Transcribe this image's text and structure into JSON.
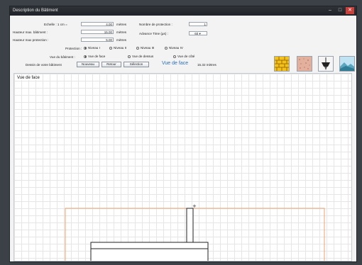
{
  "window": {
    "title": "Description du Bâtiment",
    "controls": [
      "–",
      "□",
      "✕"
    ]
  },
  "form": {
    "echelle": {
      "label": "Echelle : 1 cm =",
      "value": "4.00",
      "unit": "mètres"
    },
    "hauteur_batiment": {
      "label": "Hauteur max. bâtiment :",
      "value": "15.00",
      "unit": "mètres"
    },
    "hauteur_protection": {
      "label": "Hauteur max protection :",
      "value": "5.00",
      "unit": "mètres"
    },
    "nombre_protection": {
      "label": "Nombre de protection :",
      "value": "1"
    },
    "avance_time": {
      "label": "Advance Time (µs) :",
      "value": "60"
    },
    "protection": {
      "label": "Protection :",
      "options": [
        "Niveau I",
        "Niveau II",
        "Niveau III",
        "Niveau IV"
      ],
      "selected": 0
    },
    "vue": {
      "label": "Vue du bâtiment :",
      "options": [
        "Vue de face",
        "Vue de dessus",
        "Vue de côté"
      ],
      "selected": 0
    },
    "dessin_label": "Dessin de votre bâtiment",
    "buttons": {
      "nouveau": "Nouveau",
      "retour": "Retour",
      "selection": "Sélection"
    },
    "view_title": "Vue de face",
    "coords": "15.32 mètres"
  },
  "tools": [
    "brick-wall-icon",
    "stone-texture-icon",
    "lightning-rod-icon",
    "landscape-icon"
  ],
  "canvas": {
    "title": "Vue de face"
  },
  "colors": {
    "accent": "#2a6fb5",
    "protection_line": "#f0a070",
    "building_outline": "#222222"
  }
}
